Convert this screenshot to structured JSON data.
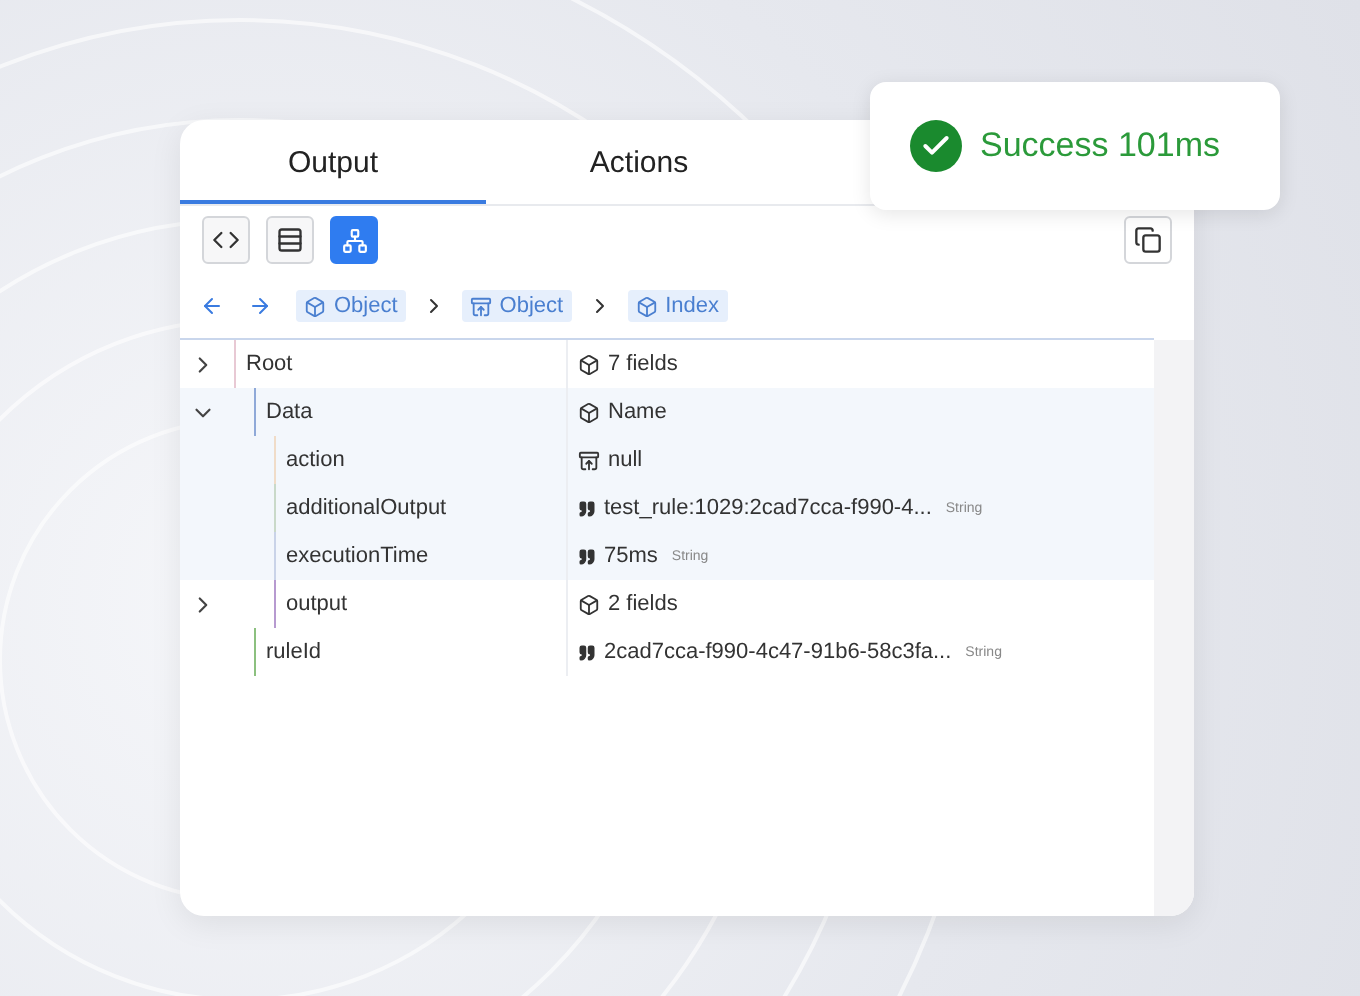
{
  "tabs": [
    {
      "label": "Output",
      "selected": true
    },
    {
      "label": "Actions",
      "selected": false
    }
  ],
  "toast": {
    "text": "Success 101ms"
  },
  "view_buttons": [
    {
      "kind": "code",
      "selected": false
    },
    {
      "kind": "table",
      "selected": false
    },
    {
      "kind": "tree",
      "selected": true
    }
  ],
  "breadcrumbs": [
    {
      "kind": "object",
      "label": "Object"
    },
    {
      "kind": "array",
      "label": "Object"
    },
    {
      "kind": "object",
      "label": "Index"
    }
  ],
  "tree": [
    {
      "key": "Root",
      "expanded": false,
      "highlighted": false,
      "color": "#e8c9d4",
      "value": {
        "kind": "object",
        "text": "7 fields"
      },
      "children": [
        {
          "key": "Data",
          "expanded": true,
          "highlighted": true,
          "color": "#8fa9d8",
          "value": {
            "kind": "object",
            "text": "Name"
          },
          "children": [
            {
              "key": "action",
              "highlighted": true,
              "color": "#f0dcc8",
              "value": {
                "kind": "array",
                "text": "null"
              }
            },
            {
              "key": "additionalOutput",
              "highlighted": true,
              "color": "#c9d9c9",
              "value": {
                "kind": "string",
                "text": "test_rule:1029:2cad7cca-f990-4...",
                "type": "String"
              }
            },
            {
              "key": "executionTime",
              "highlighted": true,
              "color": "#c9d3e8",
              "value": {
                "kind": "string",
                "text": "75ms",
                "type": "String"
              }
            },
            {
              "key": "output",
              "expanded": false,
              "highlighted": false,
              "color": "#b79ad0",
              "value": {
                "kind": "object",
                "text": "2 fields"
              }
            }
          ]
        },
        {
          "key": "ruleId",
          "highlighted": false,
          "color": "#8cc07f",
          "value": {
            "kind": "string",
            "text": "2cad7cca-f990-4c47-91b6-58c3fa...",
            "type": "String"
          }
        }
      ]
    }
  ]
}
